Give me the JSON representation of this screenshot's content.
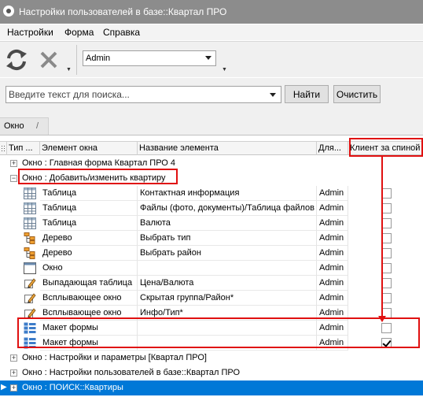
{
  "window": {
    "title": "Настройки пользователей в базе::Квартал ПРО"
  },
  "menu": {
    "items": [
      "Настройки",
      "Форма",
      "Справка"
    ]
  },
  "toolbar": {
    "user_value": "Admin"
  },
  "search": {
    "placeholder": "Введите текст для поиска...",
    "find_label": "Найти",
    "clear_label": "Очистить"
  },
  "tab": {
    "label": "Окно"
  },
  "grid": {
    "columns": [
      "Тип ...",
      "Элемент окна",
      "Название элемента",
      "Для...",
      "Клиент за спиной"
    ],
    "groups_top": [
      "Окно : Главная форма Квартал ПРО 4",
      "Окно : Добавить/изменить квартиру"
    ],
    "rows": [
      {
        "icon": "table-icon",
        "element": "Таблица",
        "name": "Контактная информация",
        "user": "Admin",
        "checked": false
      },
      {
        "icon": "table-icon",
        "element": "Таблица",
        "name": "Файлы (фото, документы)/Таблица файлов",
        "user": "Admin",
        "checked": false
      },
      {
        "icon": "table-icon",
        "element": "Таблица",
        "name": "Валюта",
        "user": "Admin",
        "checked": false
      },
      {
        "icon": "tree-icon",
        "element": "Дерево",
        "name": "Выбрать тип",
        "user": "Admin",
        "checked": false
      },
      {
        "icon": "tree-icon",
        "element": "Дерево",
        "name": "Выбрать район",
        "user": "Admin",
        "checked": false
      },
      {
        "icon": "window-icon",
        "element": "Окно",
        "name": "",
        "user": "Admin",
        "checked": false
      },
      {
        "icon": "pencil-icon",
        "element": "Выпадающая таблица",
        "name": "Цена/Валюта",
        "user": "Admin",
        "checked": false
      },
      {
        "icon": "pencil-icon",
        "element": "Всплывающее окно",
        "name": "Скрытая группа/Район*",
        "user": "Admin",
        "checked": false
      },
      {
        "icon": "pencil-icon",
        "element": "Всплывающее окно",
        "name": "Инфо/Тип*",
        "user": "Admin",
        "checked": false
      },
      {
        "icon": "form-layout-icon",
        "element": "Макет формы",
        "name": "",
        "user": "Admin",
        "checked": false
      },
      {
        "icon": "form-layout-icon",
        "element": "Макет формы",
        "name": "",
        "user": "Admin",
        "checked": true
      }
    ],
    "groups_bottom": [
      "Окно : Настройки и параметры [Квартал ПРО]",
      "Окно : Настройки пользователей в базе::Квартал ПРО",
      "Окно : ПОИСК::Квартиры"
    ]
  },
  "colors": {
    "annotation": "#e01010",
    "selection": "#0078d7",
    "titlebar": "#8c8c8c"
  }
}
